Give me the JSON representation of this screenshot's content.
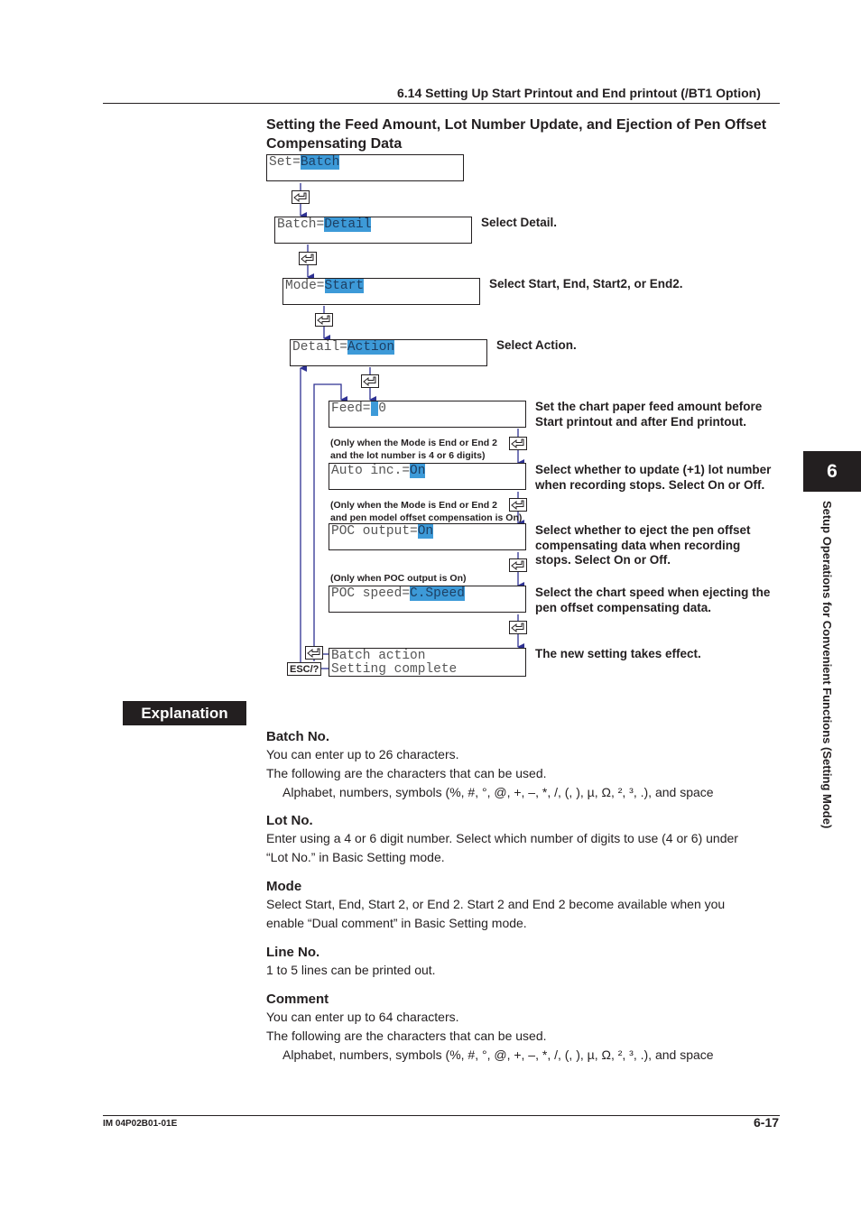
{
  "header": {
    "section": "6.14  Setting Up Start Printout and End printout (/BT1 Option)"
  },
  "section_title": "Setting the Feed Amount, Lot Number Update, and Ejection of Pen Offset Compensating Data",
  "flow": {
    "screens": [
      {
        "label": "Set=",
        "value": "Batch"
      },
      {
        "label": "Batch=",
        "value": "Detail",
        "note": "Select Detail."
      },
      {
        "label": "Mode=",
        "value": "Start",
        "note": "Select Start, End, Start2, or End2."
      },
      {
        "label": "Detail=",
        "value": "Action",
        "note": "Select Action."
      },
      {
        "label": "Feed=",
        "value": " ",
        "suffix": "0",
        "note": "Set the chart paper feed amount before Start printout and after End printout."
      },
      {
        "label": "Auto inc.=",
        "value": "On",
        "condition": "(Only when the Mode is End or End 2 and the lot number is 4 or 6 digits)",
        "note": "Select whether to update (+1) lot number when recording stops. Select On or Off."
      },
      {
        "label": "POC output=",
        "value": "On",
        "condition": "(Only when the Mode is End or End 2 and pen model offset compensation is On)",
        "note": "Select whether to eject the pen offset compensating data when recording stops. Select On or Off."
      },
      {
        "label": "POC speed=",
        "value": "C.Speed",
        "condition": "(Only when POC output is On)",
        "note": "Select the chart speed when ejecting the pen offset compensating data."
      }
    ],
    "final": {
      "line1": "Batch action",
      "line2": "Setting complete",
      "note": "The new setting takes effect."
    },
    "keys": {
      "enter_icon": "enter-key-icon",
      "esc_label": "ESC/?"
    },
    "cond_lines": {
      "c1a": "(Only when the Mode is End or End 2",
      "c1b": "and the lot number is 4 or 6 digits)",
      "c2a": "(Only when the Mode is End or End 2",
      "c2b": "and pen model offset compensation is On)",
      "c3": "(Only when POC output is On)"
    }
  },
  "explanation": {
    "label": "Explanation",
    "items": [
      {
        "title": "Batch No.",
        "lines": [
          "You can enter up to 26 characters.",
          "The following are the characters that can be used."
        ],
        "chars": "Alphabet, numbers, symbols (%, #, °, @, +, –, *, /, (, ), µ, Ω, ², ³, .), and space"
      },
      {
        "title": "Lot No.",
        "lines": [
          "Enter using a 4 or 6 digit number. Select which number of digits to use (4 or 6) under",
          "“Lot No.” in Basic Setting mode."
        ]
      },
      {
        "title": "Mode",
        "lines": [
          "Select Start, End, Start 2, or End 2. Start 2 and End 2 become available when you",
          "enable “Dual comment” in Basic Setting mode."
        ]
      },
      {
        "title": "Line No.",
        "lines": [
          "1 to 5 lines can be printed out."
        ]
      },
      {
        "title": "Comment",
        "lines": [
          "You can enter up to 64 characters.",
          "The following are the characters that can be used."
        ],
        "chars": "Alphabet, numbers, symbols (%, #, °, @, +, –, *, /, (, ), µ, Ω, ², ³, .), and space"
      }
    ]
  },
  "side_tab": {
    "number": "6",
    "title": "Setup Operations for Convenient Functions (Setting Mode)"
  },
  "footer": {
    "doc_id": "IM 04P02B01-01E",
    "page": "6-17"
  }
}
